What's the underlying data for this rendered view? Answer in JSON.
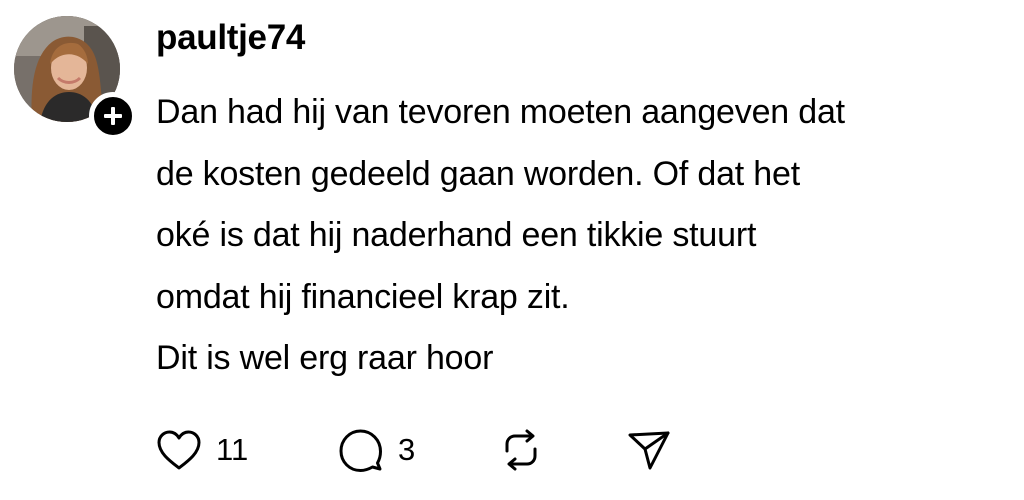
{
  "post": {
    "username": "paultje74",
    "lines": [
      "Dan had hij van tevoren moeten aangeven dat",
      "de kosten gedeeld gaan worden. Of dat het",
      "oké is dat hij naderhand een tikkie stuurt",
      "omdat hij financieel krap zit.",
      "Dit is wel erg raar hoor"
    ],
    "actions": {
      "like_icon": "heart-icon",
      "like_count": "11",
      "reply_icon": "speech-bubble-icon",
      "reply_count": "3",
      "repost_icon": "repost-icon",
      "share_icon": "send-icon"
    }
  },
  "colors": {
    "text": "#000000",
    "background": "#ffffff",
    "badge": "#000000"
  }
}
